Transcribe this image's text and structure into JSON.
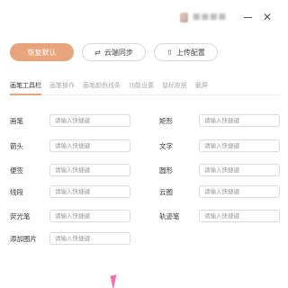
{
  "header": {
    "close_glyph": "✕"
  },
  "toolbar": {
    "reset_label": "恢复默认",
    "sync_label": "云端同步",
    "upload_label": "上传配置",
    "sync_icon": "sync-icon",
    "upload_icon": "upload-icon"
  },
  "tabs": [
    {
      "label": "画笔工具栏",
      "active": true
    },
    {
      "label": "画笔操作",
      "active": false
    },
    {
      "label": "画笔颜色线条",
      "active": false
    },
    {
      "label": "功能设置",
      "active": false
    },
    {
      "label": "鼠标皮肤",
      "active": false
    },
    {
      "label": "截屏",
      "active": false
    }
  ],
  "shortcuts": {
    "left": [
      {
        "label": "画笔",
        "value": "",
        "placeholder": "请输入快捷键"
      },
      {
        "label": "箭头",
        "value": "",
        "placeholder": "请输入快捷键"
      },
      {
        "label": "便签",
        "value": "",
        "placeholder": "请输入快捷键"
      },
      {
        "label": "线段",
        "value": "",
        "placeholder": "请输入快捷键"
      },
      {
        "label": "荧光笔",
        "value": "",
        "placeholder": "请输入快捷键"
      },
      {
        "label": "添加图片",
        "value": "",
        "placeholder": "请输入快捷键"
      }
    ],
    "right": [
      {
        "label": "矩形",
        "value": "",
        "placeholder": "请输入快捷键"
      },
      {
        "label": "文字",
        "value": "",
        "placeholder": "请输入快捷键"
      },
      {
        "label": "圆形",
        "value": "",
        "placeholder": "请输入快捷键"
      },
      {
        "label": "云图",
        "value": "",
        "placeholder": "请输入快捷键"
      },
      {
        "label": "轨迹笔",
        "value": "",
        "placeholder": "请输入快捷键"
      }
    ]
  },
  "colors": {
    "accent": "#e8a57c",
    "cursor": "#f06fb0"
  }
}
